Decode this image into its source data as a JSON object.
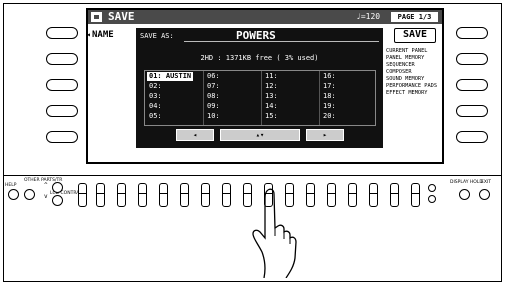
{
  "lcd": {
    "title": "SAVE",
    "tempo": "♩=120",
    "page": "PAGE 1/3",
    "name_label": "NAME",
    "name_arrow": "◂",
    "save_button": "SAVE",
    "save_as_label": "SAVE AS:",
    "save_as_value": "POWERS",
    "disk_info": "2HD : 1371KB free ( 3% used)",
    "files": [
      [
        "01: AUSTIN",
        "02:",
        "03:",
        "04:",
        "05:"
      ],
      [
        "06:",
        "07:",
        "08:",
        "09:",
        "10:"
      ],
      [
        "11:",
        "12:",
        "13:",
        "14:",
        "15:"
      ],
      [
        "16:",
        "17:",
        "18:",
        "19:",
        "20:"
      ]
    ],
    "nav": {
      "left": "◂",
      "center": "▴▾",
      "right": "▸"
    },
    "save_types": [
      "CURRENT PANEL",
      "PANEL MEMORY",
      "SEQUENCER",
      "COMPOSER",
      "SOUND MEMORY",
      "PERFORMANCE PADS",
      "EFFECT MEMORY"
    ]
  },
  "panel": {
    "help": "HELP",
    "other_parts": "OTHER PARTS/TR",
    "lcd_contrast": "LCD CONTRAST",
    "display_hold": "DISPLAY HOLD",
    "exit": "EXIT",
    "up_arrow": "^",
    "down_arrow": "v"
  }
}
